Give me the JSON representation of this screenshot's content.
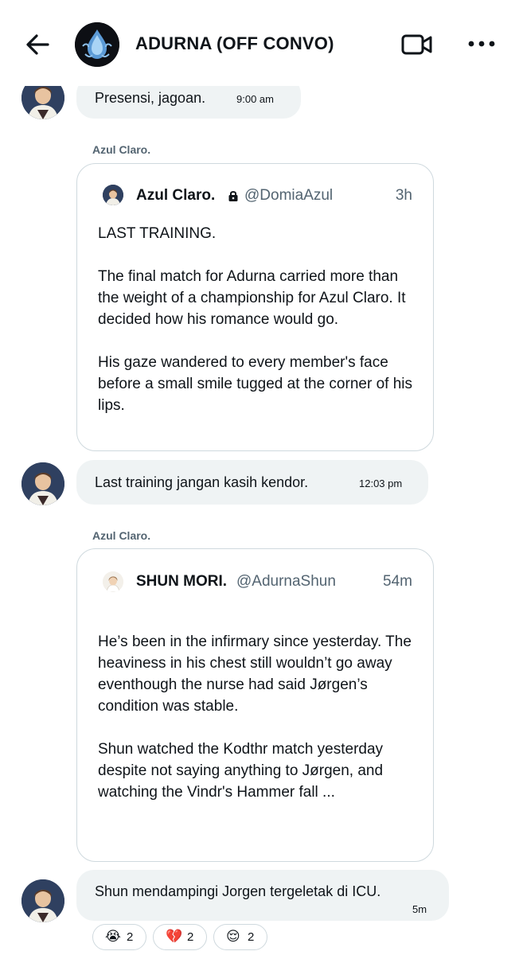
{
  "header": {
    "title": "ADURNA (OFF CONVO)",
    "back_icon": "back-arrow-icon",
    "video_icon": "video-camera-icon",
    "more_icon": "more-dots-icon"
  },
  "messages": [
    {
      "text": "Presensi, jagoan.",
      "time": "9:00 am"
    },
    {
      "text": "Last training jangan kasih kendor.",
      "time": "12:03 pm"
    },
    {
      "text": "Shun mendampingi Jorgen tergeletak di ICU.",
      "time": "5m"
    }
  ],
  "quotes": [
    {
      "sender_label": "Azul Claro.",
      "author_name": "Azul Claro.",
      "author_handle": "@DomiaAzul",
      "author_locked": true,
      "age": "3h",
      "paragraphs": [
        "LAST TRAINING.",
        "The final match for Adurna carried more than the weight of a championship for Azul Claro. It decided how his romance would go.",
        "His gaze wandered to every member's face before a small smile tugged at the corner of his lips."
      ]
    },
    {
      "sender_label": "Azul Claro.",
      "author_name": "SHUN MORI.",
      "author_handle": "@AdurnaShun",
      "age": "54m",
      "paragraphs": [
        "He’s been in the infirmary since yesterday. The heaviness in his chest still wouldn’t go away eventhough the nurse had said Jørgen’s condition was stable.",
        "Shun watched the Kodthr match yesterday despite not saying anything to Jørgen, and watching the Vindr's Hammer fall ..."
      ]
    }
  ],
  "reactions": [
    {
      "emoji": "😭",
      "count": "2"
    },
    {
      "emoji": "💔",
      "count": "2"
    },
    {
      "emoji": "😌",
      "count": "2"
    }
  ],
  "colors": {
    "bubble_bg": "#eff3f4",
    "border": "#cfd9de",
    "secondary_text": "#536471",
    "primary_text": "#0f1419"
  }
}
